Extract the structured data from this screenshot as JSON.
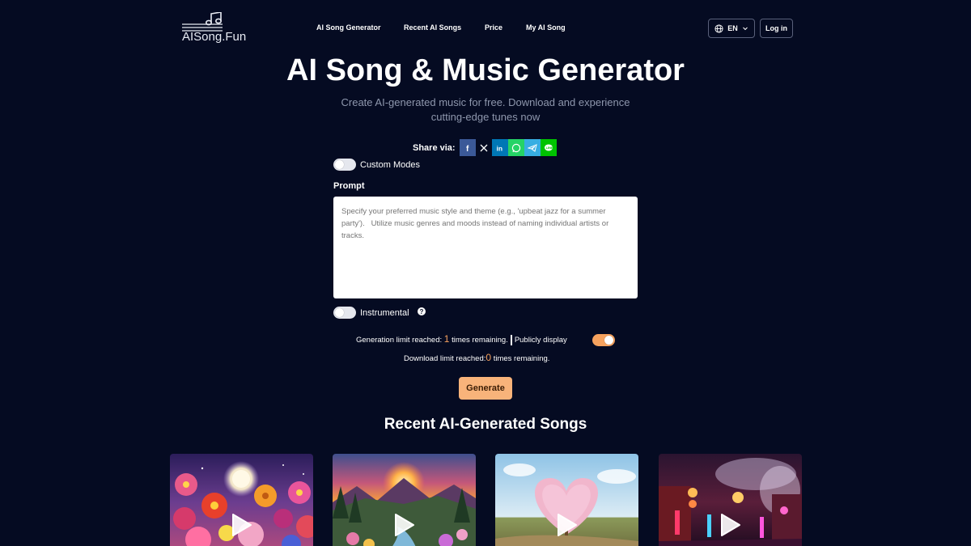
{
  "header": {
    "logo_text": "AISong.Fun",
    "nav": [
      "AI Song Generator",
      "Recent AI Songs",
      "Price",
      "My AI Song"
    ],
    "language": "EN",
    "login": "Log in"
  },
  "hero": {
    "title": "AI Song & Music Generator",
    "subtitle": "Create AI-generated music for free. Download and experience cutting-edge tunes now"
  },
  "share": {
    "label": "Share via:",
    "targets": [
      "facebook",
      "x",
      "linkedin",
      "whatsapp",
      "telegram",
      "line"
    ]
  },
  "form": {
    "custom_modes_label": "Custom Modes",
    "custom_modes_on": false,
    "prompt_label": "Prompt",
    "prompt_placeholder": "Specify your preferred music style and theme (e.g., 'upbeat jazz for a summer party').   Utilize music genres and moods instead of naming individual artists or tracks.",
    "instrumental_label": "Instrumental",
    "instrumental_on": false,
    "generation_prefix": "Generation limit reached:",
    "generation_count": "1",
    "generation_suffix": "times remaining.",
    "public_label": "Publicly display",
    "public_on": true,
    "download_prefix": "Download limit reached:",
    "download_count": "0",
    "download_suffix": "times remaining.",
    "generate_label": "Generate"
  },
  "recent": {
    "title": "Recent AI-Generated Songs",
    "cards": [
      {
        "image": "flowers-moon"
      },
      {
        "image": "sunset-mountains-river"
      },
      {
        "image": "heart-tree-field"
      },
      {
        "image": "neon-temple-street"
      }
    ]
  },
  "colors": {
    "background": "#050b22",
    "accent": "#f6a25e",
    "button": "#f8b37a",
    "muted": "#8e97ad"
  }
}
